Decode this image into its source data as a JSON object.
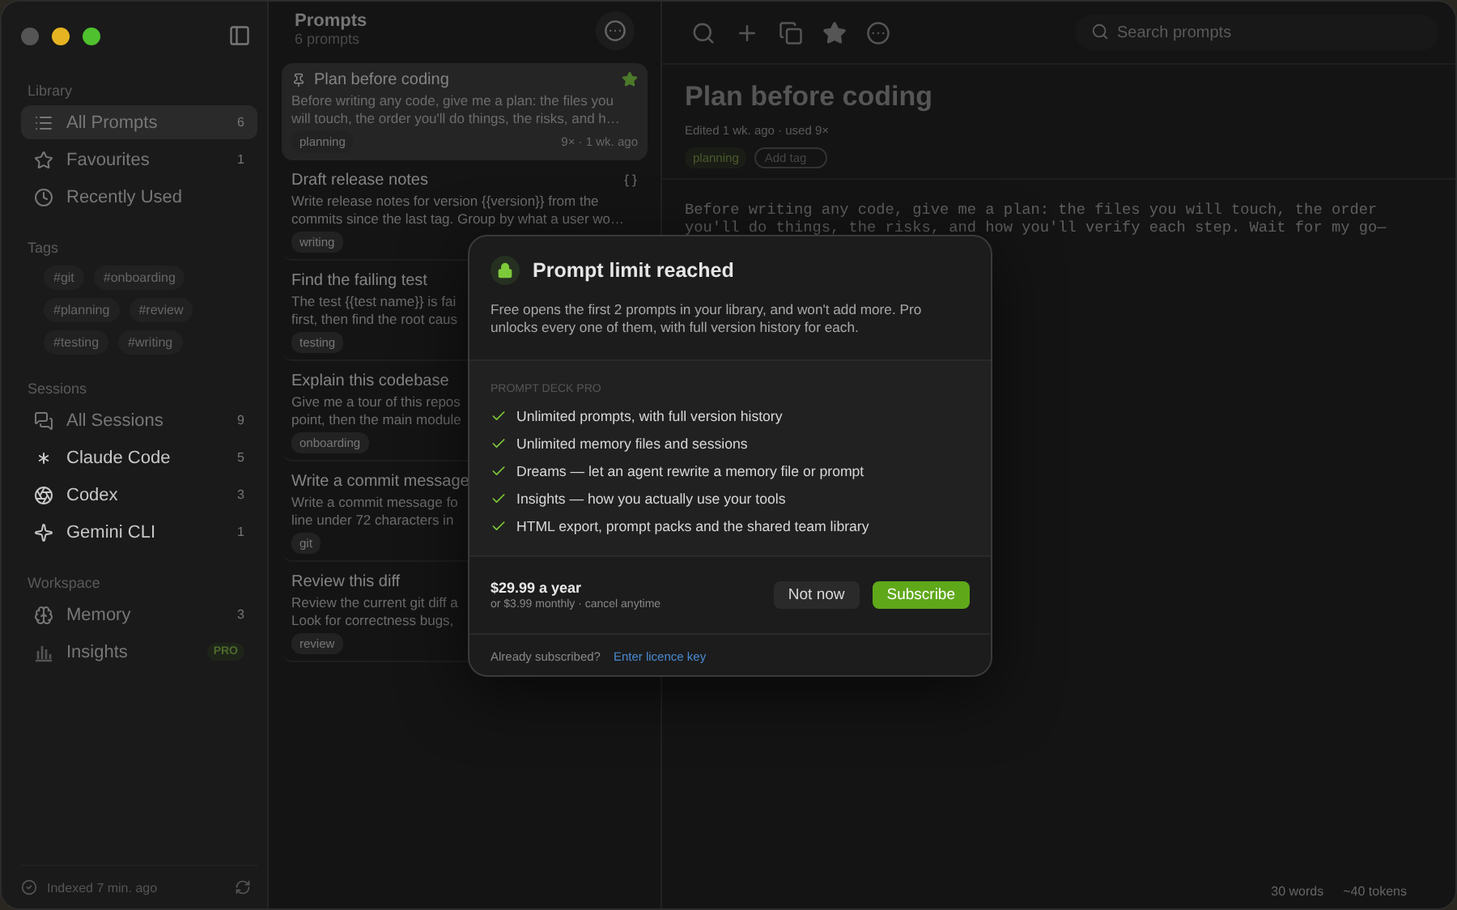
{
  "sidebar": {
    "sections": [
      {
        "kind": "nav",
        "title": "Library",
        "items": [
          {
            "label": "All Prompts",
            "count": "6",
            "selected": true,
            "dimmed": true
          },
          {
            "label": "Favourites",
            "count": "1",
            "selected": false,
            "dimmed": true
          },
          {
            "label": "Recently Used",
            "selected": false,
            "dimmed": true
          }
        ]
      },
      {
        "kind": "tags",
        "title": "Tags",
        "tags": [
          "#git",
          "#onboarding",
          "#planning",
          "#review",
          "#testing",
          "#writing"
        ]
      },
      {
        "kind": "nav",
        "title": "Sessions",
        "items": [
          {
            "label": "All Sessions",
            "count": "9",
            "selected": false,
            "dimmed": true
          },
          {
            "label": "Claude Code",
            "count": "5",
            "selected": false,
            "dimmed": false
          },
          {
            "label": "Codex",
            "count": "3",
            "selected": false,
            "dimmed": false
          },
          {
            "label": "Gemini CLI",
            "count": "1",
            "selected": false,
            "dimmed": false
          }
        ]
      },
      {
        "kind": "nav",
        "title": "Workspace",
        "items": [
          {
            "label": "Memory",
            "count": "3",
            "selected": false,
            "dimmed": true
          },
          {
            "label": "Insights",
            "badge": "PRO",
            "selected": false,
            "dimmed": true
          }
        ]
      }
    ],
    "status": "Indexed 7 min. ago"
  },
  "list": {
    "title": "Prompts",
    "subtitle": "6 prompts",
    "items": [
      {
        "title": "Plan before coding",
        "pinned": true,
        "starred": true,
        "template": false,
        "selected": true,
        "preview": [
          "Before writing any code, give me a plan: the files you",
          "will touch, the order you'll do things, the risks, and h…"
        ],
        "tag": "planning",
        "meta": "9× · 1 wk. ago"
      },
      {
        "title": "Draft release notes",
        "pinned": false,
        "starred": false,
        "template": true,
        "selected": false,
        "preview": [
          "Write release notes for version {{version}} from the",
          "commits since the last tag. Group by what a user wo…"
        ],
        "tag": "writing"
      },
      {
        "title": "Find the failing test",
        "pinned": false,
        "selected": false,
        "preview": [
          "The test {{test name}} is fai",
          "first, then find the root caus"
        ],
        "tag": "testing"
      },
      {
        "title": "Explain this codebase",
        "pinned": false,
        "selected": false,
        "preview": [
          "Give me a tour of this repos",
          "point, then the main module"
        ],
        "tag": "onboarding"
      },
      {
        "title": "Write a commit message",
        "pinned": false,
        "selected": false,
        "preview": [
          "Write a commit message fo",
          "line under 72 characters in"
        ],
        "tag": "git"
      },
      {
        "title": "Review this diff",
        "pinned": false,
        "selected": false,
        "preview": [
          "Review the current git diff a",
          "Look for correctness bugs,"
        ],
        "tag": "review"
      }
    ]
  },
  "detail": {
    "search": {
      "placeholder": "Search prompts"
    },
    "title": "Plan before coding",
    "meta": "Edited 1 wk. ago · used 9×",
    "tags": [
      "planning"
    ],
    "add_tag": "Add tag",
    "body": [
      "Before writing any code, give me a plan: the files you will touch, the order",
      "you'll do things, the risks, and how you'll verify each step. Wait for my go—"
    ],
    "footer": [
      "30 words",
      "~40 tokens"
    ]
  },
  "modal": {
    "title": "Prompt limit reached",
    "text": "Free opens the first 2 prompts in your library, and won't add more. Pro unlocks every one of them, with full version history for each.",
    "section": "PROMPT DECK PRO",
    "features": [
      "Unlimited prompts, with full version history",
      "Unlimited memory files and sessions",
      "Dreams — let an agent rewrite a memory file or prompt",
      "Insights — how you actually use your tools",
      "HTML export, prompt packs and the shared team library"
    ],
    "price": "$29.99 a year",
    "price_note": "or $3.99 monthly · cancel anytime",
    "buttons": [
      "Not now",
      "Subscribe"
    ],
    "footer_text": "Already subscribed?",
    "footer_link": "Enter licence key"
  }
}
